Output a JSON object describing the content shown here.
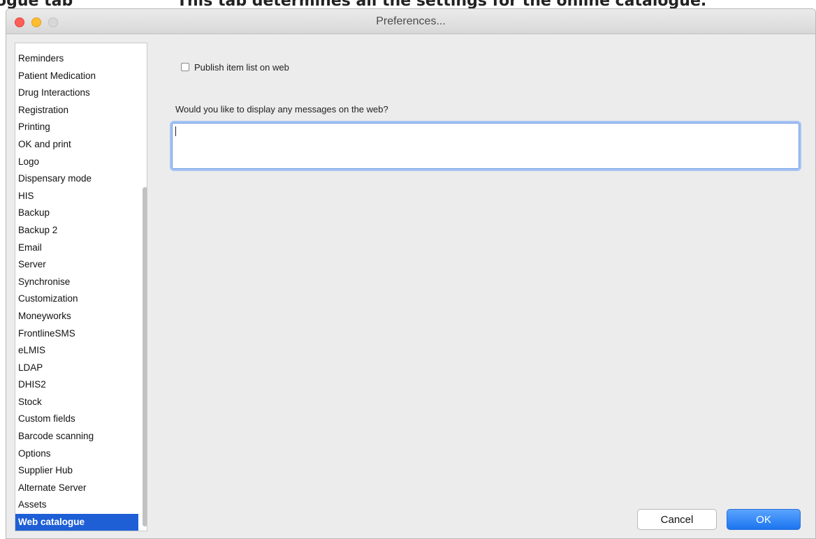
{
  "document": {
    "heading_left": "ogue tab",
    "heading_right": "This tab determines all the settings for the online catalogue."
  },
  "window": {
    "title": "Preferences..."
  },
  "sidebar": {
    "items": [
      {
        "label": "Reminders"
      },
      {
        "label": "Patient Medication"
      },
      {
        "label": "Drug Interactions"
      },
      {
        "label": "Registration"
      },
      {
        "label": "Printing"
      },
      {
        "label": "OK and print"
      },
      {
        "label": "Logo"
      },
      {
        "label": "Dispensary mode"
      },
      {
        "label": "HIS"
      },
      {
        "label": "Backup"
      },
      {
        "label": "Backup 2"
      },
      {
        "label": "Email"
      },
      {
        "label": "Server"
      },
      {
        "label": "Synchronise"
      },
      {
        "label": "Customization"
      },
      {
        "label": "Moneyworks"
      },
      {
        "label": "FrontlineSMS"
      },
      {
        "label": "eLMIS"
      },
      {
        "label": "LDAP"
      },
      {
        "label": "DHIS2"
      },
      {
        "label": "Stock"
      },
      {
        "label": "Custom fields"
      },
      {
        "label": "Barcode scanning"
      },
      {
        "label": "Options"
      },
      {
        "label": "Supplier Hub"
      },
      {
        "label": "Alternate Server"
      },
      {
        "label": "Assets"
      },
      {
        "label": "Web catalogue",
        "selected": true
      }
    ]
  },
  "main": {
    "publish_checkbox": {
      "label": "Publish item list on web",
      "checked": false
    },
    "message_question": "Would you like to display any messages on the web?",
    "message_value": ""
  },
  "buttons": {
    "cancel_label": "Cancel",
    "ok_label": "OK"
  },
  "colors": {
    "selection": "#1e5fd6",
    "ok_button": "#1b74ef",
    "focus_ring": "#a7c4f2"
  }
}
